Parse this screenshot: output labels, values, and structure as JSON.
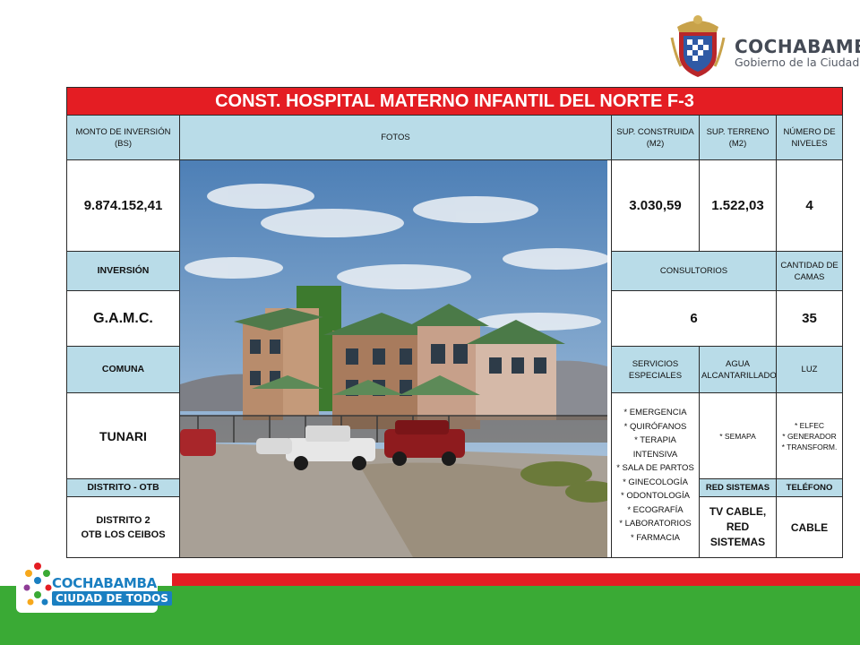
{
  "header": {
    "gov_title": "COCHABAMBA",
    "gov_subtitle": "Gobierno de la Ciudad"
  },
  "table": {
    "title": "CONST. HOSPITAL MATERNO INFANTIL DEL NORTE F-3",
    "headers": {
      "monto": "MONTO DE INVERSIÓN (BS)",
      "fotos": "FOTOS",
      "sup_construida": "SUP. CONSTRUIDA (M2)",
      "sup_terreno": "SUP. TERRENO (M2)",
      "niveles": "NÚMERO DE NIVELES",
      "inversion": "INVERSIÓN",
      "consultorios": "CONSULTORIOS",
      "camas": "CANTIDAD DE CAMAS",
      "comuna": "COMUNA",
      "servicios": "SERVICIOS ESPECIALES",
      "agua": "AGUA ALCANTARILLADO",
      "luz": "LUZ",
      "distrito": "DISTRITO - OTB",
      "red": "RED SISTEMAS",
      "telefono": "TELÉFONO"
    },
    "values": {
      "monto": "9.874.152,41",
      "sup_construida": "3.030,59",
      "sup_terreno": "1.522,03",
      "niveles": "4",
      "inversion": "G.A.M.C.",
      "consultorios": "6",
      "camas": "35",
      "comuna": "TUNARI",
      "agua": "* SEMAPA",
      "distrito_line1": "DISTRITO 2",
      "distrito_line2": "OTB LOS CEIBOS",
      "red": "TV CABLE, RED SISTEMAS",
      "telefono": "CABLE"
    },
    "servicios": [
      "* EMERGENCIA",
      "* QUIRÓFANOS",
      "* TERAPIA INTENSIVA",
      "* SALA DE PARTOS",
      "* GINECOLOGÍA",
      "* ODONTOLOGÍA",
      "* ECOGRAFÍA",
      "* LABORATORIOS",
      "* FARMACIA"
    ],
    "luz": [
      "* ELFEC",
      "* GENERADOR",
      "* TRANSFORM."
    ]
  },
  "footer": {
    "logo_line1": "COCHABAMBA",
    "logo_line2": "CIUDAD DE TODOS"
  }
}
